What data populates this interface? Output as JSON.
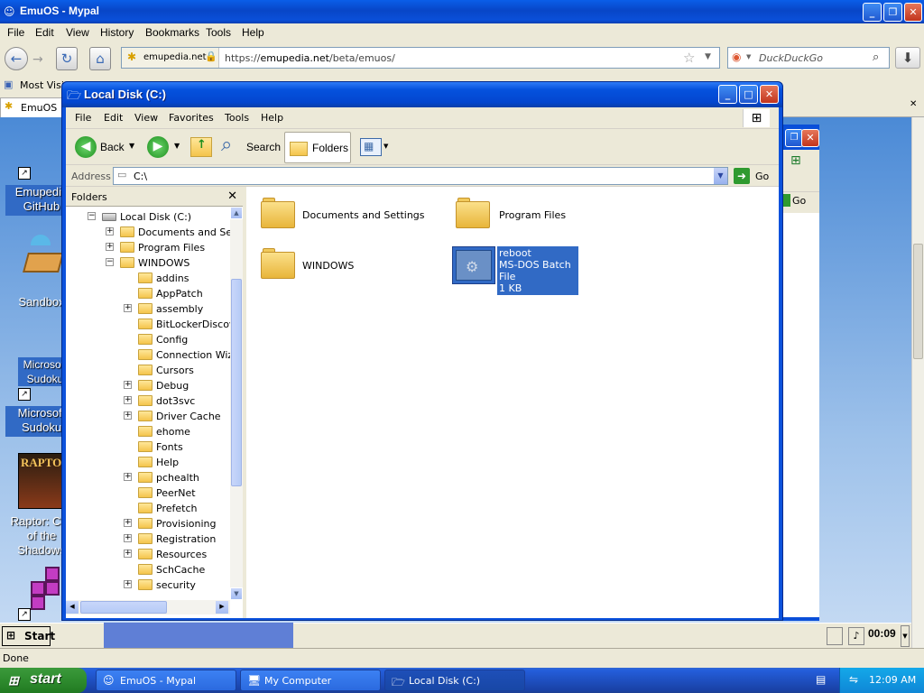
{
  "browser": {
    "title": "EmuOS - Mypal",
    "menu": [
      "File",
      "Edit",
      "View",
      "History",
      "Bookmarks",
      "Tools",
      "Help"
    ],
    "identity": "emupedia.net",
    "url_prefix": "https://",
    "url_host": "emupedia.net",
    "url_path": "/beta/emuos/",
    "search_placeholder": "DuckDuckGo",
    "bookmarks_label": "Most Visit",
    "tab_label": "EmuOS",
    "status": "Done"
  },
  "desktop": {
    "icons": [
      "Emupedia GitHub",
      "Sandbox",
      "Microsoft Sudoku",
      "Microsoft Sudoku",
      "Raptor: Call of the Shadows"
    ],
    "emu_start": "Start",
    "emu_clock": "00:09",
    "back_go": "Go"
  },
  "explorer": {
    "title": "Local Disk (C:)",
    "menu": [
      "File",
      "Edit",
      "View",
      "Favorites",
      "Tools",
      "Help"
    ],
    "toolbar": {
      "back": "Back",
      "search": "Search",
      "folders": "Folders"
    },
    "address_label": "Address",
    "address_value": "C:\\",
    "go_label": "Go",
    "folders_title": "Folders",
    "tree": [
      {
        "label": "Local Disk (C:)",
        "level": 0,
        "expander": "minus",
        "drive": true
      },
      {
        "label": "Documents and Settings",
        "level": 1,
        "expander": "plus"
      },
      {
        "label": "Program Files",
        "level": 1,
        "expander": "plus"
      },
      {
        "label": "WINDOWS",
        "level": 1,
        "expander": "minus"
      },
      {
        "label": "addins",
        "level": 2,
        "expander": "none"
      },
      {
        "label": "AppPatch",
        "level": 2,
        "expander": "none"
      },
      {
        "label": "assembly",
        "level": 2,
        "expander": "plus"
      },
      {
        "label": "BitLockerDiscovery",
        "level": 2,
        "expander": "none"
      },
      {
        "label": "Config",
        "level": 2,
        "expander": "none"
      },
      {
        "label": "Connection Wizard",
        "level": 2,
        "expander": "none"
      },
      {
        "label": "Cursors",
        "level": 2,
        "expander": "none"
      },
      {
        "label": "Debug",
        "level": 2,
        "expander": "plus"
      },
      {
        "label": "dot3svc",
        "level": 2,
        "expander": "plus"
      },
      {
        "label": "Driver Cache",
        "level": 2,
        "expander": "plus"
      },
      {
        "label": "ehome",
        "level": 2,
        "expander": "none"
      },
      {
        "label": "Fonts",
        "level": 2,
        "expander": "none"
      },
      {
        "label": "Help",
        "level": 2,
        "expander": "none"
      },
      {
        "label": "pchealth",
        "level": 2,
        "expander": "plus"
      },
      {
        "label": "PeerNet",
        "level": 2,
        "expander": "none"
      },
      {
        "label": "Prefetch",
        "level": 2,
        "expander": "none"
      },
      {
        "label": "Provisioning",
        "level": 2,
        "expander": "plus"
      },
      {
        "label": "Registration",
        "level": 2,
        "expander": "plus"
      },
      {
        "label": "Resources",
        "level": 2,
        "expander": "plus"
      },
      {
        "label": "SchCache",
        "level": 2,
        "expander": "none"
      },
      {
        "label": "security",
        "level": 2,
        "expander": "plus"
      }
    ],
    "files": [
      {
        "name": "Documents and Settings",
        "type": "folder"
      },
      {
        "name": "Program Files",
        "type": "folder"
      },
      {
        "name": "WINDOWS",
        "type": "folder"
      },
      {
        "name": "reboot",
        "type": "batch",
        "description": "MS-DOS Batch File",
        "size": "1 KB"
      }
    ]
  },
  "taskbar": {
    "start": "start",
    "tasks": [
      {
        "label": "EmuOS - Mypal",
        "icon": "mypal-icon"
      },
      {
        "label": "My Computer",
        "icon": "my-computer-icon"
      },
      {
        "label": "Local Disk (C:)",
        "icon": "folder-icon",
        "active": true
      }
    ],
    "clock": "12:09 AM"
  }
}
